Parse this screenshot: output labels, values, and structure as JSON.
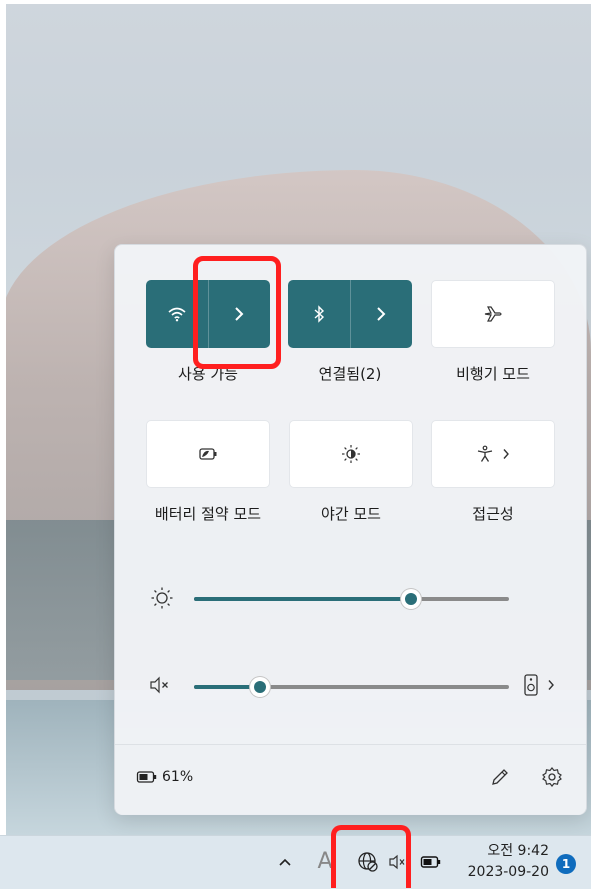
{
  "quick_settings": {
    "wifi": {
      "label": "사용 가능",
      "state": "on"
    },
    "bluetooth": {
      "label": "연결됨(2)",
      "state": "on"
    },
    "airplane": {
      "label": "비행기 모드",
      "state": "off"
    },
    "battery_saver": {
      "label": "배터리 절약 모드",
      "state": "off"
    },
    "night_light": {
      "label": "야간 모드",
      "state": "off"
    },
    "accessibility": {
      "label": "접근성",
      "state": "off"
    }
  },
  "sliders": {
    "brightness": {
      "value_percent": 69
    },
    "volume": {
      "value_percent": 21
    }
  },
  "footer": {
    "battery_text": "61%"
  },
  "taskbar": {
    "ime_label": "A",
    "time": "오전 9:42",
    "date": "2023-09-20",
    "notification_count": "1"
  },
  "colors": {
    "accent": "#2a6e78",
    "highlight": "#ff1f1f",
    "badge": "#0f6cbd"
  },
  "icons": [
    "wifi-icon",
    "chevron-right-icon",
    "bluetooth-icon",
    "airplane-icon",
    "battery-saver-icon",
    "night-light-icon",
    "accessibility-icon",
    "brightness-icon",
    "volume-muted-icon",
    "speaker-device-icon",
    "battery-icon",
    "pencil-icon",
    "gear-icon",
    "chevron-up-icon",
    "globe-no-network-icon"
  ]
}
